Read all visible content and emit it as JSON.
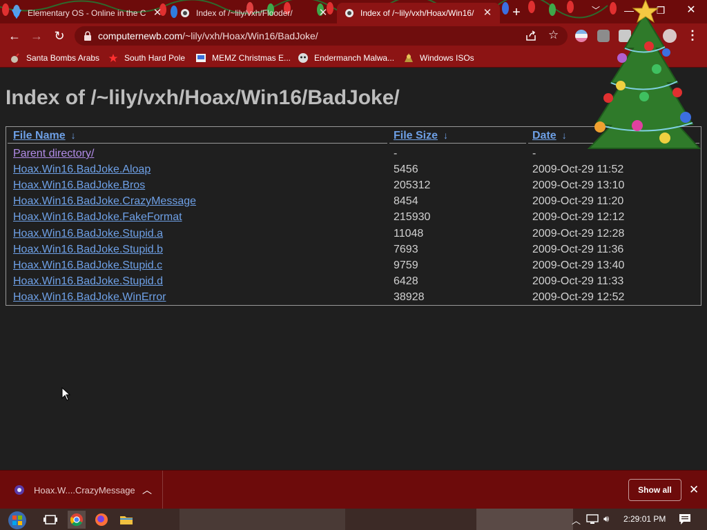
{
  "browser": {
    "tabs": [
      {
        "title": "Elementary OS - Online in the Cl",
        "active": false
      },
      {
        "title": "Index of /~lily/vxh/Flooder/",
        "active": false
      },
      {
        "title": "Index of /~lily/vxh/Hoax/Win16/",
        "active": true
      }
    ],
    "new_tab_symbol": "+",
    "address": {
      "host": "computernewb.com",
      "path": "/~lily/vxh/Hoax/Win16/BadJoke/"
    },
    "bookmarks": [
      {
        "label": "Santa Bombs Arabs",
        "icon": "bomb-icon"
      },
      {
        "label": "South Hard Pole",
        "icon": "red-star-icon"
      },
      {
        "label": "MEMZ Christmas E...",
        "icon": "memz-icon"
      },
      {
        "label": "Endermanch Malwa...",
        "icon": "endermanch-icon"
      },
      {
        "label": "Windows ISOs",
        "icon": "windows-iso-icon"
      }
    ]
  },
  "page": {
    "heading": "Index of /~lily/vxh/Hoax/Win16/BadJoke/",
    "columns": {
      "name": "File Name",
      "size": "File Size",
      "date": "Date",
      "sort_symbol": "↓"
    },
    "rows": [
      {
        "name": "Parent directory/",
        "size": "-",
        "date": "-"
      },
      {
        "name": "Hoax.Win16.BadJoke.Aloap",
        "size": "5456",
        "date": "2009-Oct-29 11:52"
      },
      {
        "name": "Hoax.Win16.BadJoke.Bros",
        "size": "205312",
        "date": "2009-Oct-29 13:10"
      },
      {
        "name": "Hoax.Win16.BadJoke.CrazyMessage",
        "size": "8454",
        "date": "2009-Oct-29 11:20"
      },
      {
        "name": "Hoax.Win16.BadJoke.FakeFormat",
        "size": "215930",
        "date": "2009-Oct-29 12:12"
      },
      {
        "name": "Hoax.Win16.BadJoke.Stupid.a",
        "size": "11048",
        "date": "2009-Oct-29 12:28"
      },
      {
        "name": "Hoax.Win16.BadJoke.Stupid.b",
        "size": "7693",
        "date": "2009-Oct-29 11:36"
      },
      {
        "name": "Hoax.Win16.BadJoke.Stupid.c",
        "size": "9759",
        "date": "2009-Oct-29 13:40"
      },
      {
        "name": "Hoax.Win16.BadJoke.Stupid.d",
        "size": "6428",
        "date": "2009-Oct-29 11:33"
      },
      {
        "name": "Hoax.Win16.BadJoke.WinError",
        "size": "38928",
        "date": "2009-Oct-29 12:52"
      }
    ]
  },
  "downloads": {
    "item": "Hoax.W....CrazyMessage",
    "show_all": "Show all"
  },
  "taskbar": {
    "clock": "2:29:01 PM"
  },
  "colors": {
    "theme_dark_red": "#6d0b0b",
    "theme_red": "#8c1414",
    "page_background": "#1f1f1f",
    "link": "#6ea0e6",
    "visited_link": "#b28ce8"
  }
}
